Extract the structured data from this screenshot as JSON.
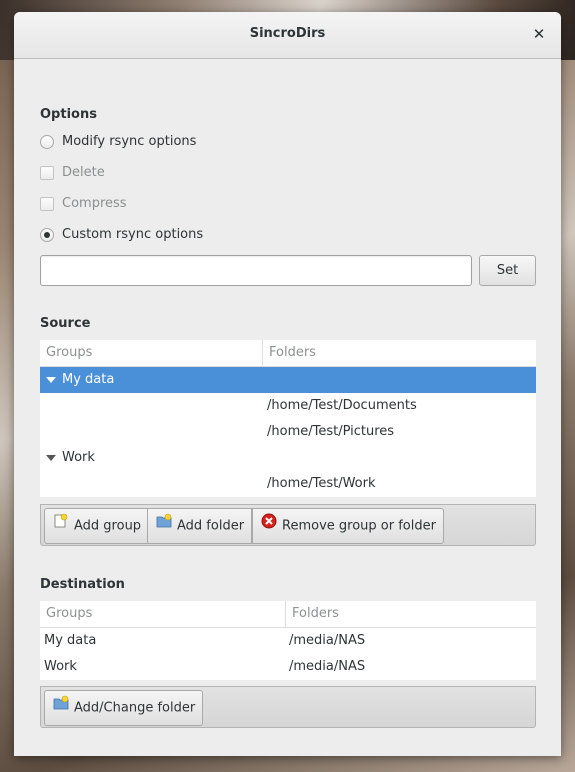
{
  "window": {
    "title": "SincroDirs"
  },
  "options": {
    "heading": "Options",
    "modify_rsync": "Modify rsync options",
    "delete": "Delete",
    "compress": "Compress",
    "custom_rsync": "Custom rsync options",
    "custom_value": "",
    "set_label": "Set"
  },
  "source": {
    "heading": "Source",
    "col_groups": "Groups",
    "col_folders": "Folders",
    "rows": [
      {
        "group": "My data",
        "folder": ""
      },
      {
        "group": "",
        "folder": "/home/Test/Documents"
      },
      {
        "group": "",
        "folder": "/home/Test/Pictures"
      },
      {
        "group": "Work",
        "folder": ""
      },
      {
        "group": "",
        "folder": "/home/Test/Work"
      }
    ],
    "add_group": "Add group",
    "add_folder": "Add folder",
    "remove": "Remove group or folder"
  },
  "destination": {
    "heading": "Destination",
    "col_groups": "Groups",
    "col_folders": "Folders",
    "rows": [
      {
        "group": "My data",
        "folder": "/media/NAS"
      },
      {
        "group": "Work",
        "folder": "/media/NAS"
      }
    ],
    "add_change": "Add/Change folder"
  },
  "colors": {
    "selection": "#4a90d9",
    "window_bg": "#ededed"
  },
  "icons": {
    "close": "close-icon",
    "radio": "radio-icon",
    "checkbox": "checkbox-icon",
    "expander": "expander-icon",
    "new_group": "new-group-icon",
    "folder_add": "folder-add-icon",
    "remove": "remove-icon"
  }
}
